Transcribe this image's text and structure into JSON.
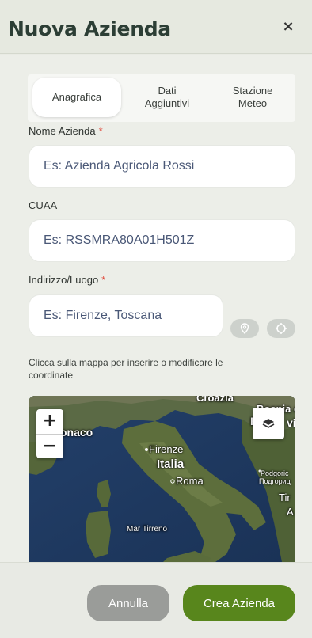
{
  "header": {
    "title": "Nuova Azienda",
    "close_label": "×"
  },
  "tabs": [
    {
      "label": "Anagrafica",
      "active": true
    },
    {
      "label": "Dati\nAggiuntivi",
      "active": false
    },
    {
      "label": "Stazione\nMeteo",
      "active": false
    }
  ],
  "form": {
    "nome": {
      "label": "Nome Azienda",
      "required_mark": "*",
      "placeholder": "Es: Azienda Agricola Rossi",
      "value": ""
    },
    "cuaa": {
      "label": "CUAA",
      "placeholder": "Es: RSSMRA80A01H501Z",
      "value": ""
    },
    "indirizzo": {
      "label": "Indirizzo/Luogo",
      "required_mark": "*",
      "placeholder": "Es: Firenze, Toscana",
      "value": ""
    }
  },
  "hint": "Clicca sulla mappa per inserire o modificare le coordinate",
  "map": {
    "zoom_in": "+",
    "zoom_out": "−",
    "labels": {
      "croazia": "Croazia",
      "bosnia": "Bosnia e",
      "bosnia2": "Ei",
      "vi": "vi",
      "monaco": "onaco",
      "firenze": "Firenze",
      "italia": "Italia",
      "roma": "Roma",
      "podgorica": "Podgoric",
      "podgorica_cyr": "Подгориц",
      "tir": "Tir",
      "a": "A",
      "mar_tirreno": "Mar Tirreno"
    }
  },
  "footer": {
    "cancel_label": "Annulla",
    "create_label": "Crea Azienda"
  },
  "colors": {
    "accent": "#58861c",
    "required": "#e04a3c",
    "cancel": "#9a9c99"
  }
}
